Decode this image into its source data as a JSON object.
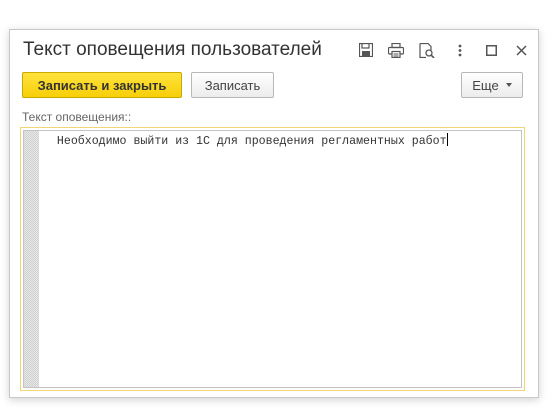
{
  "window": {
    "title": "Текст оповещения пользователей"
  },
  "titlebar_icons": [
    {
      "name": "save-icon",
      "label": "Сохранить"
    },
    {
      "name": "print-icon",
      "label": "Печать"
    },
    {
      "name": "preview-icon",
      "label": "Предварительный просмотр"
    },
    {
      "name": "more-vertical-icon",
      "label": "Ещё"
    },
    {
      "name": "maximize-icon",
      "label": "Развернуть"
    },
    {
      "name": "close-icon",
      "label": "Закрыть"
    }
  ],
  "toolbar": {
    "save_close_label": "Записать и закрыть",
    "save_label": "Записать",
    "more_label": "Еще"
  },
  "form": {
    "field_label": "Текст оповещения::",
    "field_value": "  Необходимо выйти из 1С для проведения регламентных работ"
  },
  "colors": {
    "primary_button": "#f7cf08",
    "field_focus_border": "#f0d674",
    "title_text": "#333333"
  }
}
